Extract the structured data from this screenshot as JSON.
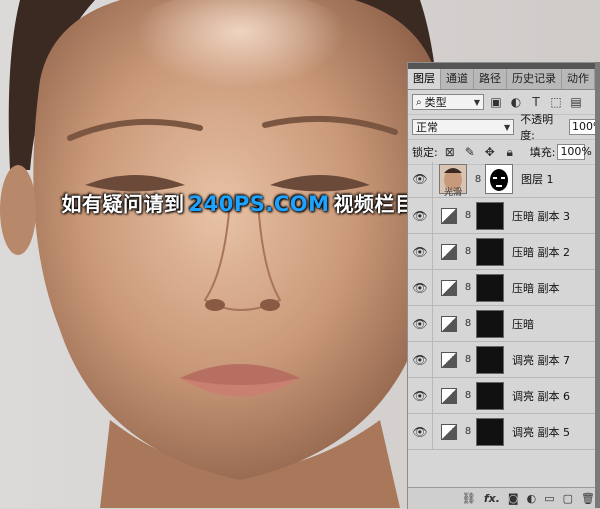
{
  "watermark": {
    "prefix": "如有疑问请到",
    "brand": "240PS.COM",
    "suffix": "视频栏目观看视频教程"
  },
  "layers_panel": {
    "tabs": [
      "图层",
      "通道",
      "路径",
      "历史记录",
      "动作"
    ],
    "filter_kind": "类型",
    "blend_mode": "正常",
    "opacity_label": "不透明度:",
    "opacity_value": "100%",
    "lock_label": "锁定:",
    "fill_label": "填充:",
    "fill_value": "100%",
    "layers": [
      {
        "name": "图层 1",
        "type": "image-with-mask"
      },
      {
        "name": "压暗 副本 3",
        "type": "adjustment"
      },
      {
        "name": "压暗 副本 2",
        "type": "adjustment"
      },
      {
        "name": "压暗 副本",
        "type": "adjustment"
      },
      {
        "name": "压暗",
        "type": "adjustment"
      },
      {
        "name": "调亮 副本 7",
        "type": "adjustment"
      },
      {
        "name": "调亮 副本 6",
        "type": "adjustment"
      },
      {
        "name": "调亮 副本 5",
        "type": "adjustment"
      }
    ],
    "hidden_layer_hint": "光滑",
    "footer_fx": "fx."
  },
  "colors": {
    "panel_bg": "#d6d6d6",
    "watermark_brand": "#1ea2ff"
  }
}
